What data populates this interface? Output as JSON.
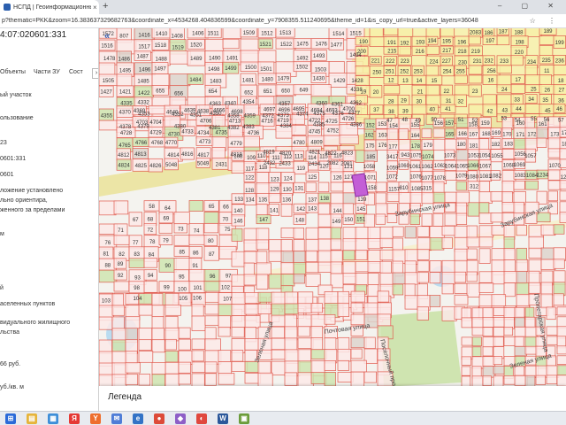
{
  "browser": {
    "tab_title": "НСПД | Геоинформационный",
    "tab_close": "×",
    "new_tab": "+",
    "window_controls": "– ▢ ✕",
    "url": "p?thematic=PKK&zoom=16.383637329682763&coordinate_x=4534268.404836599&coordinate_y=7908355.511240695&theme_id=1&is_copy_url=true&active_layers=36048",
    "address_icons": "☆ ⋮"
  },
  "panel": {
    "title": "4:07:020601:331",
    "tabs": [
      "Объекты",
      "Части ЗУ",
      "Сост"
    ],
    "tabs_more": "›",
    "lines": [
      "ый участок",
      "ользование",
      "23",
      "0601:331",
      "0601",
      "ложение установлено",
      "льно ориентира,",
      "женного за пределами",
      "м",
      "й",
      "аселенных пунктов",
      "видуального жилищного",
      "льства",
      "66 руб.",
      "уб./кв. м"
    ]
  },
  "map": {
    "collapse_icon": "«",
    "legend_label": "Легенда",
    "streets": [
      "Зарубинская улица",
      "Пролетарская улица",
      "Зеленая улица",
      "Почтовая улица",
      "Поселочный проезд",
      "Зеленая улица"
    ],
    "parcel_labels": [
      "1572",
      "807",
      "1416",
      "1410",
      "1408",
      "1406",
      "1511",
      "1509",
      "1512",
      "1513",
      "1514",
      "1515",
      "1516",
      "1517",
      "1518",
      "1519",
      "1520",
      "1521",
      "1522",
      "1475",
      "1476",
      "1477",
      "1478",
      "1486",
      "1487",
      "1488",
      "1489",
      "1490",
      "1491",
      "1492",
      "1493",
      "1494",
      "1495",
      "1496",
      "1497",
      "1498",
      "1499",
      "1500",
      "1501",
      "1502",
      "1503",
      "1505",
      "1485",
      "1484",
      "1483",
      "1481",
      "1480",
      "1479",
      "1430",
      "1429",
      "1428",
      "1427",
      "1421",
      "1422",
      "655",
      "656",
      "654",
      "652",
      "651",
      "650",
      "649",
      "4338",
      "4335",
      "4332",
      "4363",
      "4340",
      "4354",
      "4357",
      "4360",
      "4361",
      "4362",
      "4355",
      "4353",
      "4352",
      "4351",
      "4350",
      "4358",
      "4359",
      "4372",
      "4373",
      "4374",
      "4375",
      "4376",
      "4377",
      "4378",
      "4379",
      "4380",
      "4381",
      "4382",
      "4383",
      "4384",
      "4385",
      "4386",
      "4370",
      "4369",
      "4640",
      "4639",
      "4638",
      "4666",
      "4698",
      "4697",
      "4696",
      "4695",
      "4694",
      "4693",
      "4700",
      "4703",
      "4704",
      "4706",
      "4713",
      "4716",
      "4719",
      "4722",
      "4725",
      "4726",
      "4728",
      "4729",
      "4730",
      "4733",
      "4734",
      "4735",
      "4736",
      "4745",
      "4752",
      "4765",
      "4766",
      "4768",
      "4770",
      "4773",
      "4779",
      "4780",
      "4809",
      "4812",
      "4813",
      "4814",
      "4816",
      "4817",
      "4818",
      "4819",
      "4820",
      "4821",
      "4822",
      "4823",
      "4824",
      "4825",
      "4826",
      "5048",
      "5049",
      "2431",
      "2432",
      "2433",
      "2434",
      "2082",
      "2081",
      "2083",
      "186",
      "187",
      "188",
      "189",
      "190",
      "191",
      "192",
      "193",
      "194",
      "195",
      "196",
      "197",
      "198",
      "199",
      "200",
      "215",
      "216",
      "217",
      "218",
      "219",
      "220",
      "221",
      "222",
      "223",
      "224",
      "227",
      "230",
      "231",
      "232",
      "233",
      "234",
      "235",
      "236",
      "250",
      "251",
      "252",
      "253",
      "254",
      "255",
      "256",
      "11",
      "12",
      "13",
      "14",
      "15",
      "16",
      "17",
      "18",
      "19",
      "20",
      "21",
      "22",
      "23",
      "24",
      "25",
      "26",
      "27",
      "28",
      "29",
      "30",
      "31",
      "32",
      "33",
      "34",
      "35",
      "36",
      "37",
      "38",
      "39",
      "40",
      "41",
      "42",
      "43",
      "44",
      "45",
      "46",
      "47",
      "48",
      "49",
      "50",
      "51",
      "52",
      "53",
      "54",
      "55",
      "56",
      "57",
      "58",
      "64",
      "65",
      "66",
      "67",
      "68",
      "69",
      "70",
      "71",
      "72",
      "73",
      "74",
      "75",
      "76",
      "77",
      "78",
      "79",
      "80",
      "81",
      "82",
      "83",
      "84",
      "85",
      "86",
      "87",
      "88",
      "89",
      "90",
      "91",
      "92",
      "93",
      "94",
      "95",
      "96",
      "97",
      "98",
      "99",
      "100",
      "101",
      "102",
      "103",
      "104",
      "105",
      "106",
      "107",
      "108",
      "109",
      "110",
      "111",
      "112",
      "113",
      "114",
      "115",
      "116",
      "117",
      "118",
      "119",
      "120",
      "121",
      "122",
      "123",
      "124",
      "125",
      "126",
      "127",
      "128",
      "129",
      "130",
      "131",
      "132",
      "133",
      "134",
      "135",
      "136",
      "137",
      "138",
      "139",
      "140",
      "141",
      "142",
      "143",
      "144",
      "145",
      "146",
      "147",
      "148",
      "149",
      "150",
      "151",
      "152",
      "153",
      "154",
      "155",
      "156",
      "157",
      "158",
      "159",
      "160",
      "161",
      "162",
      "163",
      "164",
      "165",
      "166",
      "167",
      "168",
      "169",
      "170",
      "171",
      "172",
      "173",
      "174",
      "175",
      "176",
      "177",
      "178",
      "179",
      "180",
      "181",
      "182",
      "183",
      "184",
      "185",
      "3417",
      "943",
      "1075",
      "1074",
      "1073",
      "1053",
      "1054",
      "1055",
      "1056",
      "1057",
      "1058",
      "1059",
      "1060",
      "1061",
      "1062",
      "1063",
      "1064",
      "1065",
      "1066",
      "1067",
      "1068",
      "1069",
      "1070",
      "1071",
      "1072",
      "1076",
      "1077",
      "1078",
      "1079",
      "1080",
      "1081",
      "1082",
      "1083",
      "1084",
      "1234",
      "1206",
      "1158",
      "1157",
      "810",
      "1085",
      "315",
      "312"
    ],
    "colors": {
      "parcel_fill": "#fbe9e7",
      "parcel_stroke": "#e05a4e",
      "yellow": "#f7f0a8",
      "green": "#cfe4b0",
      "road": "#e8e2a8",
      "water": "#b9dcf0",
      "selected": "#c35fd6",
      "map_bg": "#f4f3ef",
      "building": "#ddd3cc"
    }
  },
  "taskbar": {
    "icons": [
      {
        "name": "windows-start-icon",
        "glyph": "⊞",
        "color": "#2b6ad8"
      },
      {
        "name": "file-explorer-icon",
        "glyph": "▤",
        "color": "#e6b43a"
      },
      {
        "name": "store-icon",
        "glyph": "▦",
        "color": "#3d8ed8"
      },
      {
        "name": "yandex-icon",
        "glyph": "Я",
        "color": "#e53935"
      },
      {
        "name": "yandex-browser-icon",
        "glyph": "Y",
        "color": "#ee6e2c"
      },
      {
        "name": "mail-icon",
        "glyph": "✉",
        "color": "#4f7dd7"
      },
      {
        "name": "browser-icon",
        "glyph": "e",
        "color": "#3373c6"
      },
      {
        "name": "chrome-icon",
        "glyph": "●",
        "color": "#dd4b39"
      },
      {
        "name": "app-icon",
        "glyph": "◆",
        "color": "#8e5fc7"
      },
      {
        "name": "app2-icon",
        "glyph": "◐",
        "color": "#e0483e"
      },
      {
        "name": "word-icon",
        "glyph": "W",
        "color": "#2b579a"
      },
      {
        "name": "app3-icon",
        "glyph": "▣",
        "color": "#6b9c3a"
      }
    ]
  }
}
